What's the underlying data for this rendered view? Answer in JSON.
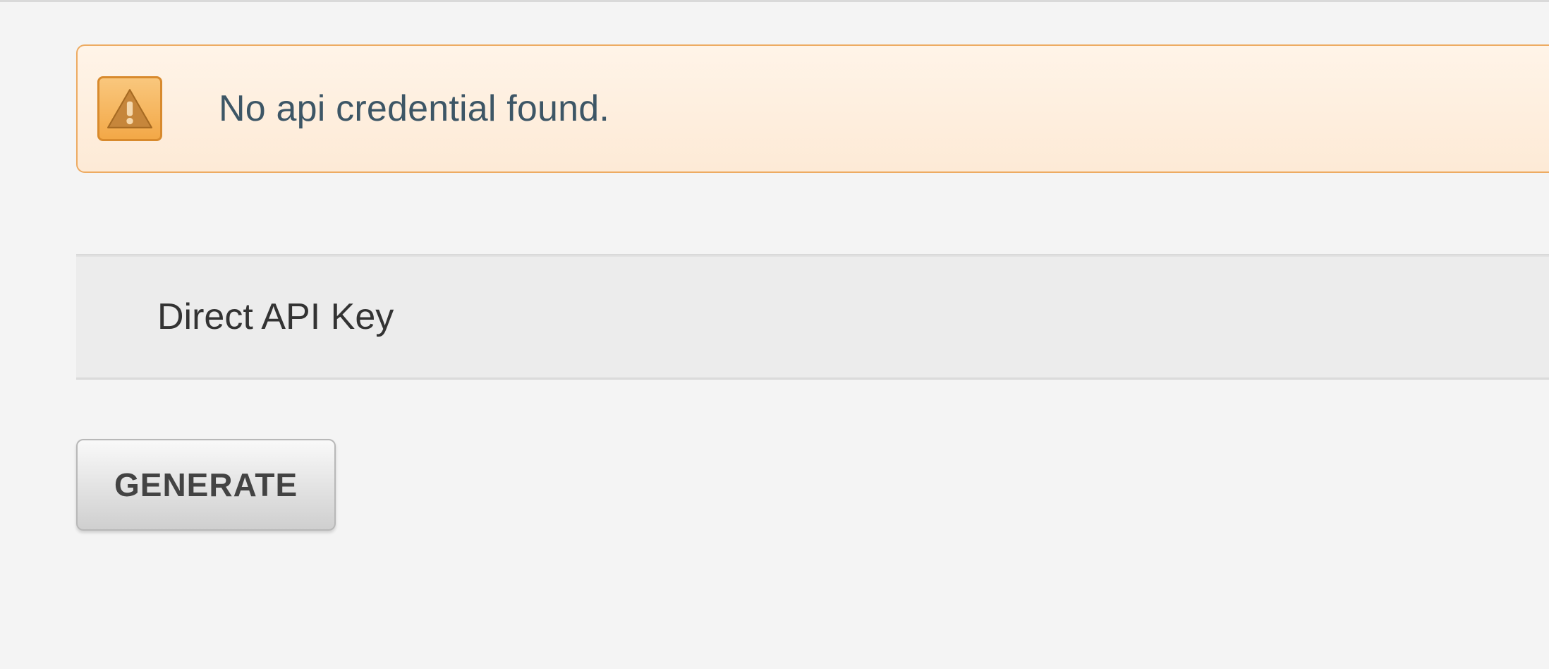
{
  "alert": {
    "message": "No api credential found."
  },
  "table": {
    "columns": [
      {
        "label": "Direct API Key"
      }
    ]
  },
  "buttons": {
    "generate": "GENERATE"
  }
}
